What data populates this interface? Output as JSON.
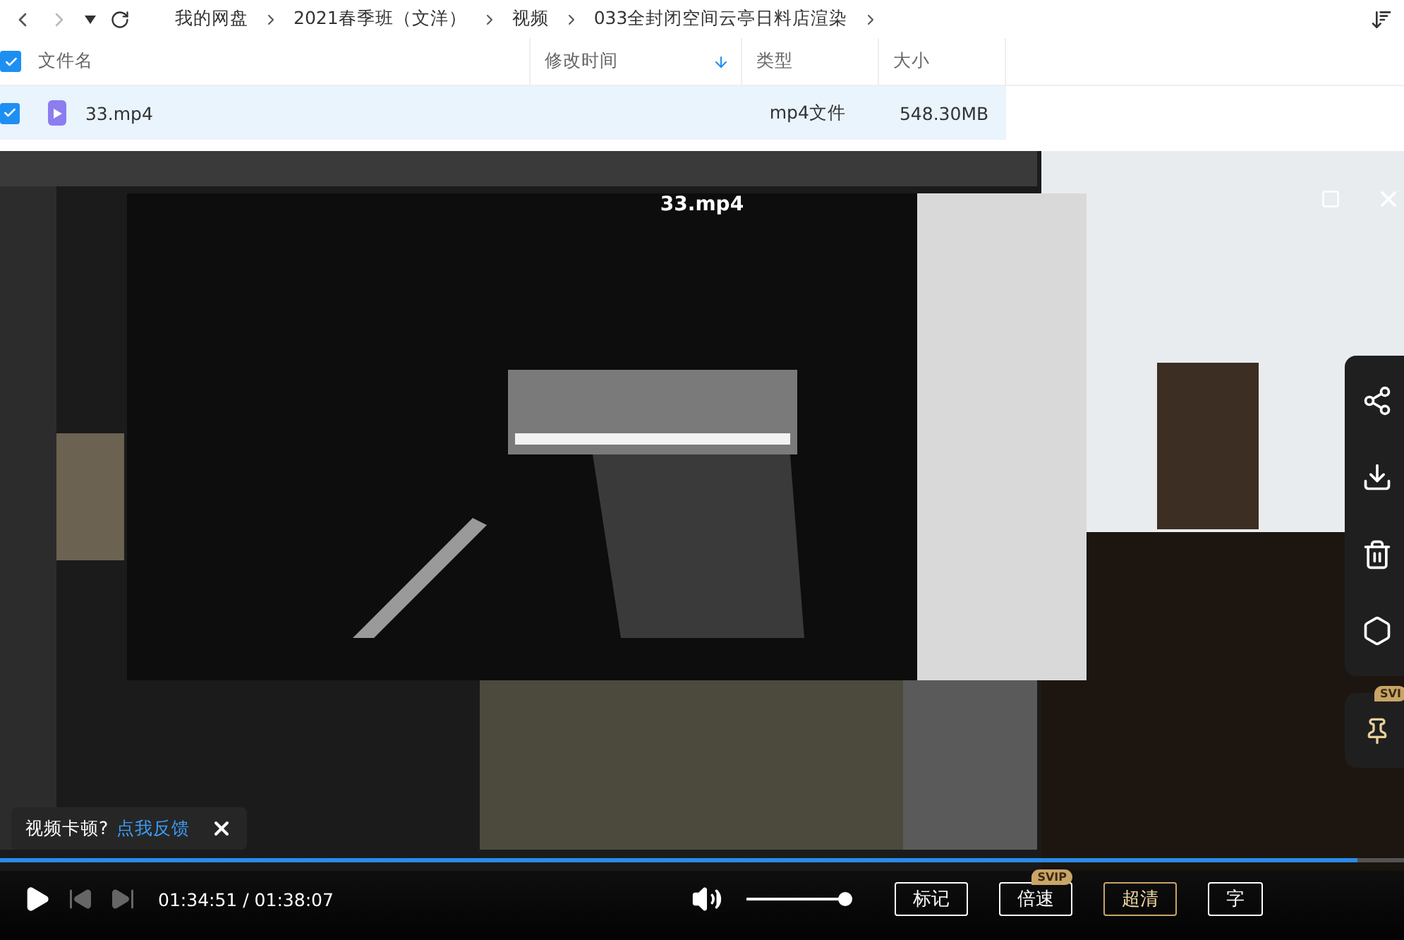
{
  "toolbar": {
    "breadcrumb": [
      "我的网盘",
      "2021春季班（文洋）",
      "视频",
      "033全封闭空间云亭日料店渲染"
    ]
  },
  "table": {
    "all_checked": true,
    "columns": [
      {
        "label": "文件名",
        "sorted": false
      },
      {
        "label": "修改时间",
        "sorted": true
      },
      {
        "label": "类型",
        "sorted": false
      },
      {
        "label": "大小",
        "sorted": false
      }
    ],
    "rows": [
      {
        "name": "33.mp4",
        "type": "mp4文件",
        "size": "548.30MB",
        "checked": true,
        "selected": true
      }
    ]
  },
  "player": {
    "title": "33.mp4",
    "progress": {
      "level": 0.967
    },
    "time": "01:34:51 / 01:38:07",
    "volume": {
      "level": 1
    },
    "feedback": {
      "text": "视频卡顿?",
      "link": "点我反馈"
    },
    "buttons": [
      {
        "label": "标记",
        "kind": "plain"
      },
      {
        "label": "倍速",
        "kind": "plain",
        "badge": "SVIP"
      },
      {
        "label": "超清",
        "kind": "gold"
      },
      {
        "label": "字",
        "kind": "plain"
      }
    ],
    "pin_badge": "SVI"
  }
}
